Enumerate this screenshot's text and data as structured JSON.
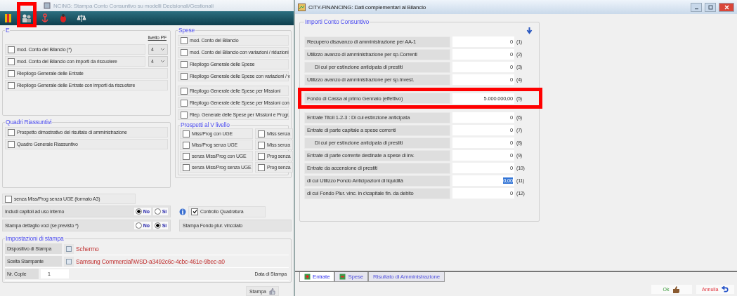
{
  "left_window": {
    "title": "NCING: Stampa Conto Consuntivo su modelli Decisionali/Gestionali",
    "toolbar": [
      {
        "kind": "flag",
        "highlighted": false
      },
      {
        "kind": "people",
        "highlighted": true
      },
      {
        "kind": "anchor",
        "highlighted": false
      },
      {
        "kind": "bug",
        "highlighted": false
      },
      {
        "kind": "scale",
        "highlighted": false
      }
    ]
  },
  "entrate": {
    "title": "E",
    "level_header": "livello PF",
    "items": [
      {
        "label": "mod. Conto del Bilancio (*)",
        "checked": false,
        "livello": "4"
      },
      {
        "label": "mod. Conto del Bilancio con importi da riscuotere",
        "checked": false,
        "livello": "4"
      },
      {
        "label": "Riepilogo Generale delle Entrate",
        "checked": false
      },
      {
        "label": "Riepilogo Generale delle Entrate con importi da riscuotere",
        "checked": false
      }
    ]
  },
  "quadri": {
    "title": "Quadri Riassuntivi",
    "items": [
      {
        "label": "Prospetto dimostrativo del risultato di amministrazione",
        "checked": false
      },
      {
        "label": "Quadro Generale Riassuntivo",
        "checked": false
      }
    ]
  },
  "spese": {
    "title": "Spese",
    "items": [
      {
        "label": "mod. Conto del Bilancio",
        "checked": false
      },
      {
        "label": "mod. Conto del Bilancio con variazioni / riduzioni",
        "checked": false
      },
      {
        "label": "Riepilogo Generale delle Spese",
        "checked": false
      },
      {
        "label": "Riepilogo Generale delle Spese con variazioni / v",
        "checked": false
      },
      {
        "label": "Riepilogo Generale delle Spese per Missioni",
        "checked": false
      },
      {
        "label": "Riepilogo Generale delle Spese per Missioni con",
        "checked": false
      },
      {
        "label": "Riep. Generale delle Spese per Missioni e Progr.",
        "checked": false
      }
    ]
  },
  "prospetti": {
    "title": "Prospetti al V livello",
    "items": [
      {
        "label": "Miss/Prog con UGE",
        "checked": false
      },
      {
        "label": "Miss senza",
        "checked": false
      },
      {
        "label": "Miss/Prog senza UGE",
        "checked": false
      },
      {
        "label": "Miss senza",
        "checked": false
      },
      {
        "label": "senza Miss/Prog con UGE",
        "checked": false
      },
      {
        "label": "Prog senza",
        "checked": false
      },
      {
        "label": "senza Miss/Prog senza UGE",
        "checked": false
      },
      {
        "label": "Prog senza",
        "checked": false
      }
    ]
  },
  "formato_a3": {
    "label": "senza Miss/Prog senza UGE (formato A3)",
    "checked": false
  },
  "options": [
    {
      "label": "Includi capitoli ad uso interno",
      "choices": [
        {
          "label": "No",
          "selected": true
        },
        {
          "label": "Si",
          "selected": false
        }
      ]
    },
    {
      "label": "Stampa dettaglio voci (se previsto *)",
      "choices": [
        {
          "label": "No",
          "selected": false
        },
        {
          "label": "Si",
          "selected": true
        }
      ]
    }
  ],
  "controllo": {
    "label": "Controllo Quadratura",
    "checked": true
  },
  "fondo_plur": {
    "label": "Stampa Fondo plur. vincolato"
  },
  "print_settings": {
    "title": "Impostazioni di stampa",
    "device_label": "Dispositivo di Stampa",
    "device": "Schermo",
    "printer_label": "Scelta Stampante",
    "printer": "Samsung Commercial\\WSD-a3492c6c-4cbc-461e-9bec-a0",
    "copies_label": "Nr. Copie",
    "copies": "1",
    "date_label": "Data di Stampa"
  },
  "print_button": "Stampa",
  "right_window": {
    "title": "CITY-FINANCING: Dati complementari al Bilancio",
    "group_title": "Importi Conto Consuntivo",
    "rows": [
      {
        "label": "Recupero disavanzo di amministrazione per AA-1",
        "value": "0",
        "index": "(1)",
        "indented": false,
        "selected": false,
        "highlighted": false
      },
      {
        "label": "Utilizzo avanzo di amministrazione per sp.Correnti",
        "value": "0",
        "index": "(2)",
        "indented": false,
        "selected": false,
        "highlighted": false
      },
      {
        "label": "Di cui per estinzione anticipata di prestiti",
        "value": "0",
        "index": "(3)",
        "indented": true,
        "selected": false,
        "highlighted": false
      },
      {
        "label": "Utilizzo avanzo di amministrazione per sp.Invest.",
        "value": "0",
        "index": "(4)",
        "indented": false,
        "selected": false,
        "highlighted": false
      },
      {
        "label": "Fondo di Cassa al primo Gennaio (effettivo)",
        "value": "5.000.000,00",
        "index": "(5)",
        "indented": false,
        "selected": false,
        "highlighted": true
      },
      {
        "label": "Entrate Titoli 1-2-3 : Di cui estinzione anticipata",
        "value": "0",
        "index": "(6)",
        "indented": false,
        "selected": false,
        "highlighted": false
      },
      {
        "label": "Entrate di parte capitale a spese correnti",
        "value": "0",
        "index": "(7)",
        "indented": false,
        "selected": false,
        "highlighted": false
      },
      {
        "label": "Di cui per estinzione anticipata di prestiti",
        "value": "0",
        "index": "(8)",
        "indented": true,
        "selected": false,
        "highlighted": false
      },
      {
        "label": "Entrate di parte corrente destinate a spese di inv.",
        "value": "0",
        "index": "(9)",
        "indented": false,
        "selected": false,
        "highlighted": false
      },
      {
        "label": "Entrate da accensione di prestiti",
        "value": "0",
        "index": "(10)",
        "indented": false,
        "selected": false,
        "highlighted": false
      },
      {
        "label": "di cui Utilizzo Fondo Anticipazioni di liquidità",
        "value": "0,00",
        "index": "(11)",
        "indented": false,
        "selected": true,
        "highlighted": false
      },
      {
        "label": "di cui Fondo Plur. vinc. in c\\capitale fin. da debito",
        "value": "0",
        "index": "(12)",
        "indented": false,
        "selected": false,
        "highlighted": false
      }
    ],
    "tabs": [
      {
        "label": "Entrate",
        "kind": "entrate",
        "selected": true
      },
      {
        "label": "Spese",
        "kind": "spese",
        "selected": false
      },
      {
        "label": "Risultato di Amministrazione",
        "kind": "plain",
        "selected": false
      }
    ],
    "buttons": [
      {
        "label": "Ok",
        "kind": "ok"
      },
      {
        "label": "Annulla",
        "kind": "cancel"
      }
    ]
  }
}
